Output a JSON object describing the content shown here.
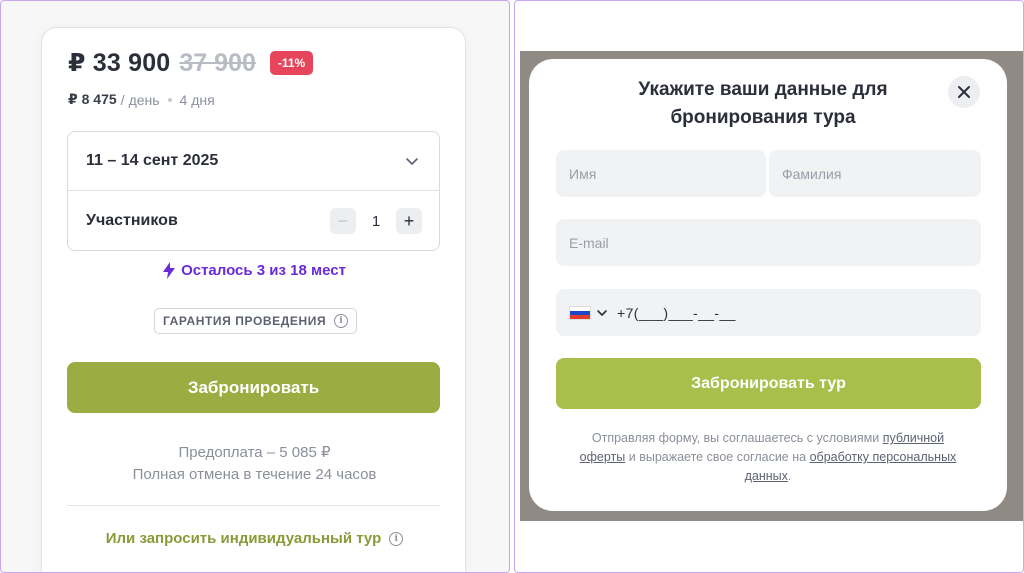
{
  "booking": {
    "price": "₽ 33 900",
    "old_price": "37 900",
    "discount": "-11%",
    "per_day_price": "₽ 8 475",
    "per_day_label": "день",
    "duration": "4 дня",
    "dates": "11 – 14 сент 2025",
    "participants_label": "Участников",
    "participants_count": "1",
    "minus": "−",
    "plus": "+",
    "seats_left": "Осталось 3 из 18 мест",
    "guarantee": "ГАРАНТИЯ ПРОВЕДЕНИЯ",
    "book_button": "Забронировать",
    "prepay": "Предоплата – 5 085 ₽",
    "cancellation": "Полная отмена в течение 24 часов",
    "individual_tour": "Или запросить индивидуальный тур"
  },
  "modal": {
    "title_line1": "Укажите ваши данные для",
    "title_line2": "бронирования тура",
    "first_name_placeholder": "Имя",
    "last_name_placeholder": "Фамилия",
    "email_placeholder": "E-mail",
    "phone_mask": "+7(___)___-__-__",
    "submit_button": "Забронировать тур",
    "consent_prefix": "Отправляя форму, вы соглашаетесь с условиями",
    "consent_link1": "публичной оферты",
    "consent_middle": "и выражаете свое согласие на",
    "consent_link2": "обработку персональных данных",
    "consent_suffix": "."
  },
  "colors": {
    "accent_green": "#9aac42",
    "accent_purple": "#6a2bd9",
    "discount_red": "#e6455c"
  }
}
